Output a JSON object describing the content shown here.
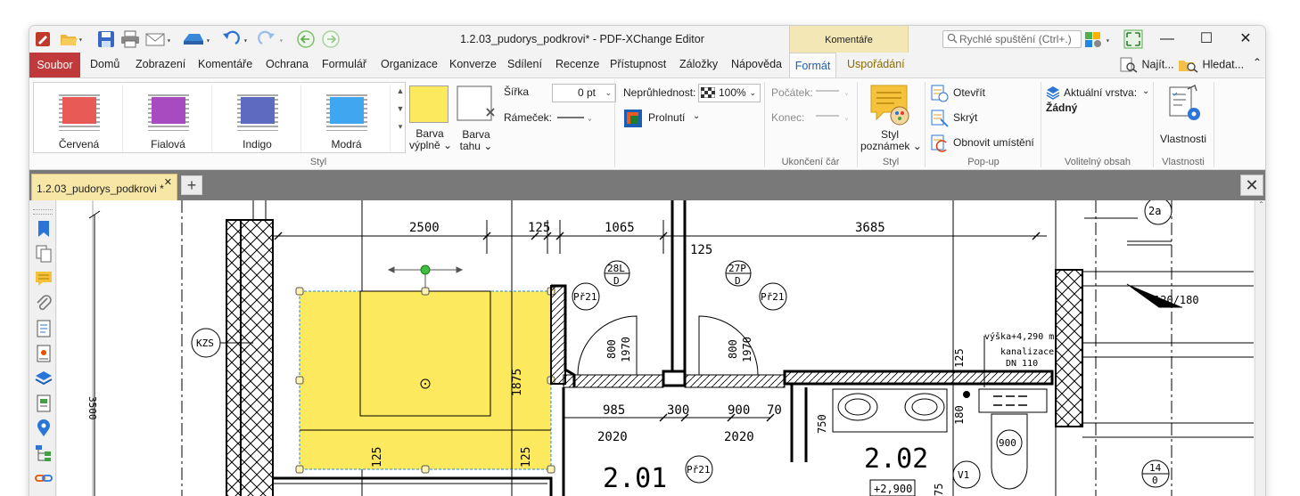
{
  "window": {
    "title": "1.2.03_pudorys_podkrovi* - PDF-XChange Editor",
    "context_tab": "Komentáře"
  },
  "search": {
    "placeholder": "Rychlé spuštění (Ctrl+.)"
  },
  "menu": {
    "file": "Soubor",
    "items": [
      "Domů",
      "Zobrazení",
      "Komentáře",
      "Ochrana",
      "Formulář",
      "Organizace",
      "Konverze",
      "Sdílení",
      "Recenze",
      "Přístupnost",
      "Záložky",
      "Nápověda"
    ],
    "active": "Formát",
    "arrange": "Uspořádání",
    "find": "Najít...",
    "search": "Hledat..."
  },
  "ribbon": {
    "styles": [
      {
        "label": "Červená",
        "color": "#e85a55"
      },
      {
        "label": "Fialová",
        "color": "#a84bc0"
      },
      {
        "label": "Indigo",
        "color": "#5c6bc0"
      },
      {
        "label": "Modrá",
        "color": "#3fa6f0"
      }
    ],
    "fill_color": {
      "line1": "Barva",
      "line2": "výplně",
      "color": "#fde95e"
    },
    "stroke_color": {
      "line1": "Barva",
      "line2": "tahu"
    },
    "width_label": "Šířka",
    "width_value": "0 pt",
    "border_label": "Rámeček:",
    "opacity_label": "Neprůhlednost:",
    "opacity_value": "100%",
    "blend_label": "Prolnutí",
    "style_group": "Styl",
    "start_label": "Počátek:",
    "end_label": "Konec:",
    "line_end_group": "Ukončení čár",
    "note_style": {
      "line1": "Styl",
      "line2": "poznámek"
    },
    "note_style_group": "Styl",
    "popup": {
      "open": "Otevřít",
      "hide": "Skrýt",
      "reset": "Obnovit umístění",
      "group": "Pop-up"
    },
    "layer": {
      "label": "Aktuální vrstva:",
      "value": "Žádný",
      "group": "Volitelný obsah"
    },
    "properties": {
      "label": "Vlastnosti",
      "group": "Vlastnosti"
    }
  },
  "doc_tab": {
    "label": "1.2.03_pudorys_podkrovi *"
  },
  "drawing": {
    "dims_top": [
      "2500",
      "125",
      "1065",
      "3685"
    ],
    "dims_mid": [
      "985",
      "300",
      "900",
      "70"
    ],
    "dims_low": [
      "2020",
      "2020"
    ],
    "dim_125": "125",
    "v_dims": [
      "800",
      "1970",
      "800",
      "1970",
      "1875",
      "125",
      "125",
      "125",
      "750",
      "180",
      "75"
    ],
    "labels": [
      "28L",
      "D",
      "27P",
      "D",
      "Př21",
      "Př21",
      "Př21",
      "KZS",
      "2.01",
      "2.02",
      "+2,900",
      "900",
      "V1",
      "14",
      "0",
      "120/180",
      "2a"
    ],
    "notes": [
      "výška+4,290 m",
      "kanalizace",
      "DN 110"
    ],
    "left_dim": "3500"
  }
}
